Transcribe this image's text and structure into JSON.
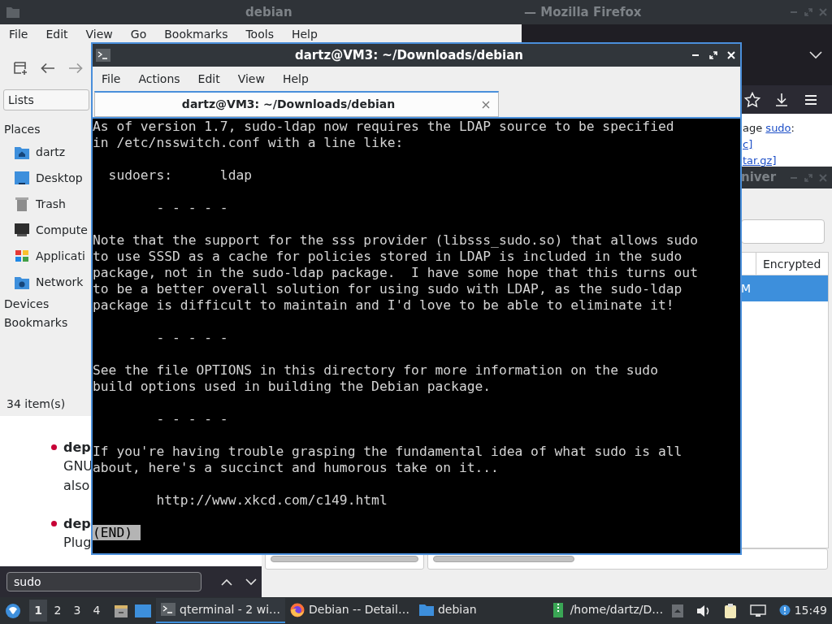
{
  "firefox": {
    "title": "— Mozilla Firefox",
    "page_lines": [
      {
        "parts": [
          {
            "text": "age ",
            "kind": "text"
          },
          {
            "text": "sudo",
            "kind": "link"
          },
          {
            "text": ":",
            "kind": "text"
          }
        ]
      },
      {
        "parts": [
          {
            "text": "c]",
            "kind": "link"
          }
        ]
      },
      {
        "parts": [
          {
            "text": "tar.gz]",
            "kind": "link"
          }
        ]
      }
    ],
    "list_items": [
      {
        "title": "dep",
        "lines": [
          "GNU",
          "also"
        ]
      },
      {
        "title": "dep",
        "lines": [
          "Plug"
        ]
      }
    ],
    "find_bar": {
      "value": "sudo"
    }
  },
  "file_manager": {
    "title": "debian",
    "menu": [
      "File",
      "Edit",
      "View",
      "Go",
      "Bookmarks",
      "Tools",
      "Help"
    ],
    "side_pane_mode": "Lists",
    "sidebar": [
      {
        "label": "Places",
        "items": [
          {
            "label": "dartz",
            "kind": "home"
          },
          {
            "label": "Desktop",
            "kind": "desktop"
          },
          {
            "label": "Trash",
            "kind": "trash"
          },
          {
            "label": "Compute",
            "kind": "computer"
          },
          {
            "label": "Applicati",
            "kind": "apps"
          },
          {
            "label": "Network",
            "kind": "network"
          }
        ]
      },
      {
        "label": "Devices"
      },
      {
        "label": "Bookmarks"
      }
    ],
    "status_bar": "34 item(s)"
  },
  "archiver": {
    "title": "niver",
    "columns": [
      "Encrypted"
    ],
    "rows": [
      {
        "cells": [
          "M"
        ],
        "selected": true
      }
    ]
  },
  "terminal": {
    "title": "dartz@VM3: ~/Downloads/debian",
    "menu": [
      "File",
      "Actions",
      "Edit",
      "View",
      "Help"
    ],
    "tabs": [
      {
        "label": "dartz@VM3: ~/Downloads/debian",
        "selected": true
      }
    ],
    "paragraphs": [
      [
        "As of version 1.7, sudo-ldap now requires the LDAP source to be specified",
        "in /etc/nsswitch.conf with a line like:"
      ],
      [
        "  sudoers:      ldap"
      ],
      [
        "        - - - - -"
      ],
      [
        "Note that the support for the sss provider (libsss_sudo.so) that allows sudo",
        "to use SSSD as a cache for policies stored in LDAP is included in the sudo",
        "package, not in the sudo-ldap package.  I have some hope that this turns out",
        "to be a better overall solution for using sudo with LDAP, as the sudo-ldap",
        "package is difficult to maintain and I'd love to be able to eliminate it!"
      ],
      [
        "        - - - - -"
      ],
      [
        "See the file OPTIONS in this directory for more information on the sudo",
        "build options used in building the Debian package."
      ],
      [
        "        - - - - -"
      ],
      [
        "If you're having trouble grasping the fundamental idea of what sudo is all",
        "about, here's a succinct and humorous take on it..."
      ],
      [
        "        http://www.xkcd.com/c149.html"
      ]
    ],
    "status": "(END)"
  },
  "taskbar": {
    "workspaces": [
      {
        "label": "1",
        "selected": true
      },
      {
        "label": "2",
        "selected": false
      },
      {
        "label": "3",
        "selected": false
      },
      {
        "label": "4",
        "selected": false
      }
    ],
    "tasks": [
      {
        "label": "qterminal - 2 wi…",
        "kind": "terminal",
        "selected": true
      },
      {
        "label": "Debian -- Detail…",
        "kind": "browser",
        "selected": false
      },
      {
        "label": "debian",
        "kind": "folder",
        "selected": false
      },
      {
        "label": "/home/dartz/D…",
        "kind": "archive",
        "selected": false
      }
    ],
    "clock": "15:49"
  }
}
